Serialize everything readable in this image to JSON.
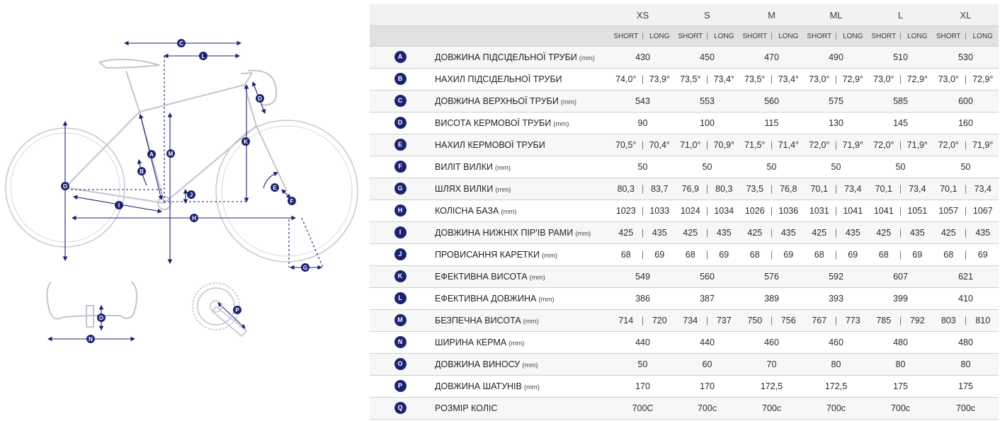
{
  "diagram": {
    "marker_labels": [
      "A",
      "B",
      "C",
      "D",
      "E",
      "F",
      "G",
      "H",
      "I",
      "J",
      "K",
      "L",
      "M",
      "N",
      "O",
      "P",
      "O"
    ]
  },
  "table": {
    "sizes": [
      "XS",
      "S",
      "M",
      "ML",
      "L",
      "XL"
    ],
    "sub_short": "SHORT",
    "sub_long": "LONG",
    "sub_sep": "|",
    "rows": [
      {
        "key": "A",
        "name": "ДОВЖИНА ПІДСІДЕЛЬНОЇ ТРУБИ",
        "unit": "(mm)",
        "values": [
          [
            "430"
          ],
          [
            "450"
          ],
          [
            "470"
          ],
          [
            "490"
          ],
          [
            "510"
          ],
          [
            "530"
          ]
        ]
      },
      {
        "key": "B",
        "name": "НАХИЛ ПІДСІДЕЛЬНОЇ ТРУБИ",
        "unit": "",
        "values": [
          [
            "74,0°",
            "73,9°"
          ],
          [
            "73,5°",
            "73,4°"
          ],
          [
            "73,5°",
            "73,4°"
          ],
          [
            "73,0°",
            "72,9°"
          ],
          [
            "73,0°",
            "72,9°"
          ],
          [
            "73,0°",
            "72,9°"
          ]
        ]
      },
      {
        "key": "C",
        "name": "ДОВЖИНА ВЕРХНЬОЇ ТРУБИ",
        "unit": "(mm)",
        "values": [
          [
            "543"
          ],
          [
            "553"
          ],
          [
            "560"
          ],
          [
            "575"
          ],
          [
            "585"
          ],
          [
            "600"
          ]
        ]
      },
      {
        "key": "D",
        "name": "ВИСОТА КЕРМОВОЇ ТРУБИ",
        "unit": "(mm)",
        "values": [
          [
            "90"
          ],
          [
            "100"
          ],
          [
            "115"
          ],
          [
            "130"
          ],
          [
            "145"
          ],
          [
            "160"
          ]
        ]
      },
      {
        "key": "E",
        "name": "НАХИЛ КЕРМОВОЇ ТРУБИ",
        "unit": "",
        "values": [
          [
            "70,5°",
            "70,4°"
          ],
          [
            "71,0°",
            "70,9°"
          ],
          [
            "71,5°",
            "71,4°"
          ],
          [
            "72,0°",
            "71,9°"
          ],
          [
            "72,0°",
            "71,9°"
          ],
          [
            "72,0°",
            "71,9°"
          ]
        ]
      },
      {
        "key": "F",
        "name": "ВИЛІТ ВИЛКИ",
        "unit": "(mm)",
        "values": [
          [
            "50"
          ],
          [
            "50"
          ],
          [
            "50"
          ],
          [
            "50"
          ],
          [
            "50"
          ],
          [
            "50"
          ]
        ]
      },
      {
        "key": "G",
        "name": "ШЛЯХ ВИЛКИ",
        "unit": "(mm)",
        "values": [
          [
            "80,3",
            "83,7"
          ],
          [
            "76,9",
            "80,3"
          ],
          [
            "73,5",
            "76,8"
          ],
          [
            "70,1",
            "73,4"
          ],
          [
            "70,1",
            "73,4"
          ],
          [
            "70,1",
            "73,4"
          ]
        ]
      },
      {
        "key": "H",
        "name": "КОЛІСНА БАЗА",
        "unit": "(mm)",
        "values": [
          [
            "1023",
            "1033"
          ],
          [
            "1024",
            "1034"
          ],
          [
            "1026",
            "1036"
          ],
          [
            "1031",
            "1041"
          ],
          [
            "1041",
            "1051"
          ],
          [
            "1057",
            "1067"
          ]
        ]
      },
      {
        "key": "I",
        "name": "ДОВЖИНА НИЖНІХ ПІР'ІВ РАМИ",
        "unit": "(mm)",
        "values": [
          [
            "425",
            "435"
          ],
          [
            "425",
            "435"
          ],
          [
            "425",
            "435"
          ],
          [
            "425",
            "435"
          ],
          [
            "425",
            "435"
          ],
          [
            "425",
            "435"
          ]
        ]
      },
      {
        "key": "J",
        "name": "ПРОВИСАННЯ КАРЕТКИ",
        "unit": "(mm)",
        "values": [
          [
            "68",
            "69"
          ],
          [
            "68",
            "69"
          ],
          [
            "68",
            "69"
          ],
          [
            "68",
            "69"
          ],
          [
            "68",
            "69"
          ],
          [
            "68",
            "69"
          ]
        ]
      },
      {
        "key": "K",
        "name": "ЕФЕКТИВНА ВИСОТА",
        "unit": "(mm)",
        "values": [
          [
            "549"
          ],
          [
            "560"
          ],
          [
            "576"
          ],
          [
            "592"
          ],
          [
            "607"
          ],
          [
            "621"
          ]
        ]
      },
      {
        "key": "L",
        "name": "ЕФЕКТИВНА ДОВЖИНА",
        "unit": "(mm)",
        "values": [
          [
            "386"
          ],
          [
            "387"
          ],
          [
            "389"
          ],
          [
            "393"
          ],
          [
            "399"
          ],
          [
            "410"
          ]
        ]
      },
      {
        "key": "M",
        "name": "БЕЗПЕЧНА ВИСОТА",
        "unit": "(mm)",
        "values": [
          [
            "714",
            "720"
          ],
          [
            "734",
            "737"
          ],
          [
            "750",
            "756"
          ],
          [
            "767",
            "773"
          ],
          [
            "785",
            "792"
          ],
          [
            "803",
            "810"
          ]
        ]
      },
      {
        "key": "N",
        "name": "ШИРИНА КЕРМА",
        "unit": "(mm)",
        "values": [
          [
            "440"
          ],
          [
            "440"
          ],
          [
            "460"
          ],
          [
            "460"
          ],
          [
            "480"
          ],
          [
            "480"
          ]
        ]
      },
      {
        "key": "O",
        "name": "ДОВЖИНА ВИНОСУ",
        "unit": "(mm)",
        "values": [
          [
            "50"
          ],
          [
            "60"
          ],
          [
            "70"
          ],
          [
            "80"
          ],
          [
            "80"
          ],
          [
            "80"
          ]
        ]
      },
      {
        "key": "P",
        "name": "ДОВЖИНА ШАТУНІВ",
        "unit": "(mm)",
        "values": [
          [
            "170"
          ],
          [
            "170"
          ],
          [
            "172,5"
          ],
          [
            "172,5"
          ],
          [
            "175"
          ],
          [
            "175"
          ]
        ]
      },
      {
        "key": "Q",
        "name": "РОЗМІР КОЛІС",
        "unit": "",
        "values": [
          [
            "700C"
          ],
          [
            "700c"
          ],
          [
            "700c"
          ],
          [
            "700c"
          ],
          [
            "700c"
          ],
          [
            "700c"
          ]
        ]
      }
    ]
  },
  "colors": {
    "badge": "#1b2371",
    "frame_line": "#c8c8d2",
    "dimension_line": "#1b2371",
    "header_bg": "#f2f2f2",
    "subheader_bg": "#e1e1e1"
  }
}
